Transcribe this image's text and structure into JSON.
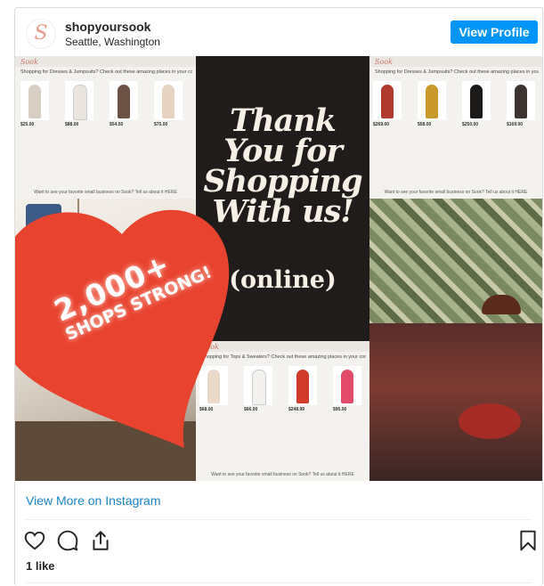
{
  "post": {
    "username": "shopyoursook",
    "location": "Seattle, Washington",
    "avatar_letter": "S",
    "view_profile_label": "View Profile",
    "view_more_label": "View More on Instagram",
    "likes": "1 like"
  },
  "image": {
    "thank_you": [
      "Thank",
      "You for",
      "Shopping",
      "With us!"
    ],
    "online": "(online)",
    "badge": {
      "big": "2,000+",
      "small": "SHOPS STRONG!"
    },
    "screens": [
      {
        "logo": "Sook",
        "headline": "Shopping for Dresses & Jumpsuits? Check out these amazing places in your community!",
        "prices": [
          "$25.00",
          "$88.00",
          "$54.50",
          "$75.00"
        ],
        "footer": "Want to see your favorite small business on Sook? Tell us about it HERE"
      },
      {
        "logo": "Sook",
        "headline": "Shopping for Dresses & Jumpsuits? Check out these amazing places in your community!",
        "prices": [
          "$269.00",
          "$58.00",
          "$250.00",
          "$169.00"
        ],
        "footer": "Want to see your favorite small business on Sook? Tell us about it HERE"
      },
      {
        "logo": "Sook",
        "headline": "Shopping for Tops & Sweaters? Check out these amazing places in your community!",
        "prices": [
          "$68.00",
          "$66.00",
          "$248.99",
          "$95.00"
        ],
        "footer": "Want to see your favorite small business on Sook? Tell us about it HERE"
      }
    ]
  },
  "colors": {
    "accent": "#0095f6",
    "heart": "#e8432f",
    "link": "#1b83c6"
  },
  "icons": [
    "heart-icon",
    "comment-icon",
    "share-icon",
    "bookmark-icon"
  ]
}
